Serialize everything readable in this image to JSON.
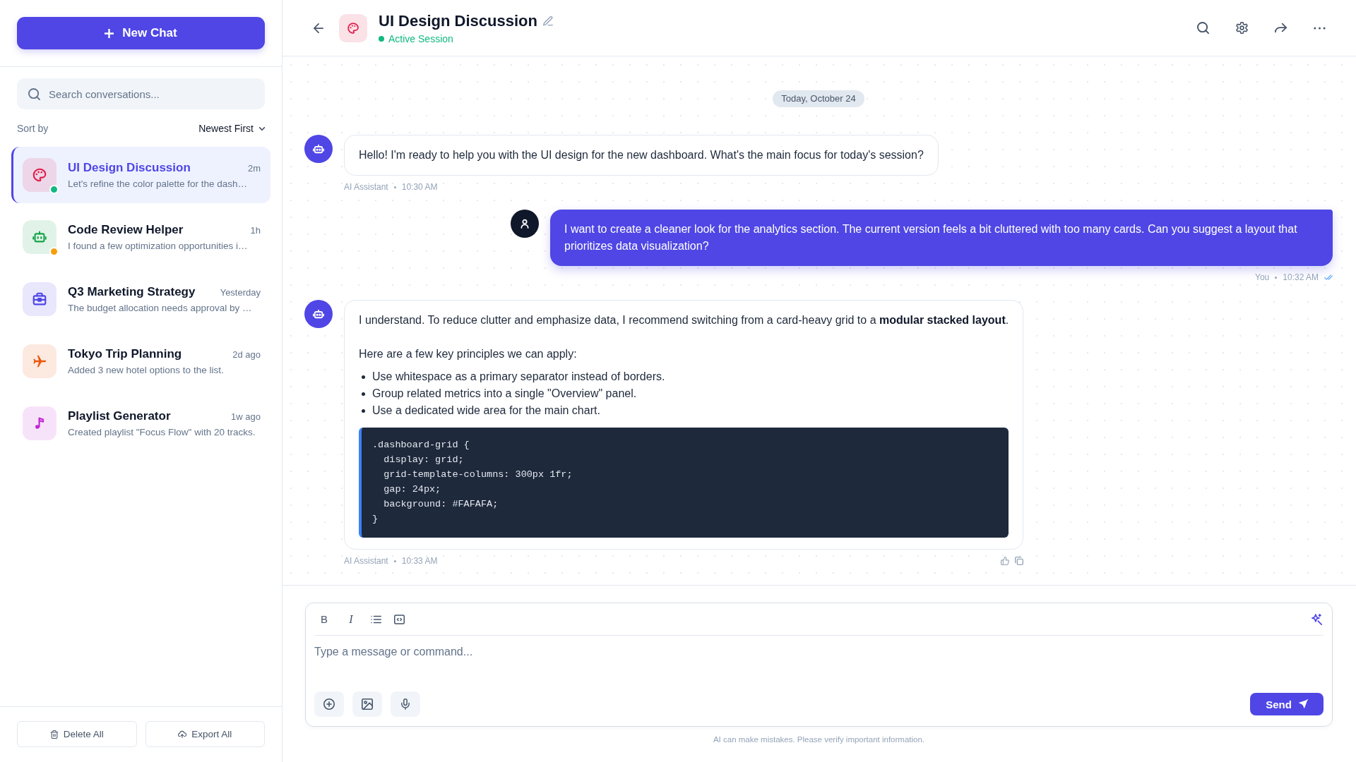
{
  "sidebar": {
    "new_chat_button": "New Chat",
    "search": {
      "placeholder": "Search conversations..."
    },
    "sort": {
      "label": "Sort by",
      "value": "Newest First"
    },
    "conversations": [
      {
        "title": "UI Design Discussion",
        "time": "2m",
        "preview": "Let's refine the color palette for the dash…",
        "color": "#e11d48",
        "status": {
          "color": "#10b981"
        },
        "selected": true
      },
      {
        "title": "Code Review Helper",
        "time": "1h",
        "preview": "I found a few optimization opportunities i…",
        "color": "#16a34a",
        "status": {
          "color": "#f59e0b"
        },
        "selected": false
      },
      {
        "title": "Q3 Marketing Strategy",
        "time": "Yesterday",
        "preview": "The budget allocation needs approval by …",
        "color": "#4f46e5",
        "selected": false
      },
      {
        "title": "Tokyo Trip Planning",
        "time": "2d ago",
        "preview": "Added 3 new hotel options to the list.",
        "color": "#ea580c",
        "selected": false
      },
      {
        "title": "Playlist Generator",
        "time": "1w ago",
        "preview": "Created playlist \"Focus Flow\" with 20 tracks.",
        "color": "#c026d3",
        "selected": false
      }
    ],
    "footer_buttons": [
      "Delete All",
      "Export All"
    ]
  },
  "header": {
    "title": "UI Design Discussion",
    "status": "Active Session"
  },
  "chat": {
    "date": "Today, October 24",
    "messages": [
      {
        "kind": "assistant",
        "sender": "AI Assistant",
        "time": "10:30 AM",
        "read": false,
        "feedback": false,
        "blocks": [
          {
            "kind": "paragraph",
            "text": "Hello! I'm ready to help you with the UI design for the new dashboard. What's the main focus for today's session?"
          }
        ]
      },
      {
        "kind": "user",
        "sender": "You",
        "time": "10:32 AM",
        "read": true,
        "feedback": false,
        "blocks": [
          {
            "kind": "paragraph",
            "text": "I want to create a cleaner look for the analytics section. The current version feels a bit cluttered with too many cards. Can you suggest a layout that prioritizes data visualization?"
          }
        ]
      },
      {
        "kind": "assistant",
        "sender": "AI Assistant",
        "time": "10:33 AM",
        "read": false,
        "feedback": true,
        "blocks": [
          {
            "kind": "paragraph",
            "text": "I understand. To reduce clutter and emphasize data, I recommend switching from a card-heavy grid to a **modular stacked layout**."
          },
          {
            "kind": "paragraph",
            "text": "Here are a few key principles we can apply:"
          },
          {
            "kind": "list",
            "items": [
              "Use whitespace as a primary separator instead of borders.",
              "Group related metrics into a single \"Overview\" panel.",
              "Use a dedicated wide area for the main chart."
            ]
          },
          {
            "kind": "code",
            "text": ".dashboard-grid {\n  display: grid;\n  grid-template-columns: 300px 1fr;\n  gap: 24px;\n  background: #FAFAFA;\n}"
          }
        ]
      }
    ]
  },
  "composer": {
    "bold": "B",
    "italic": "I",
    "placeholder": "Type a message or command...",
    "send": "Send",
    "disclaimer": "AI can make mistakes. Please verify important information."
  }
}
